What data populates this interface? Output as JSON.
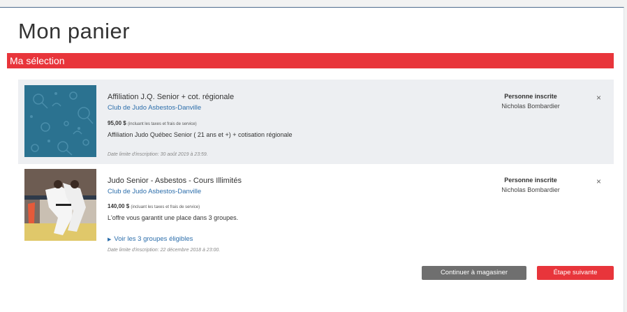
{
  "page": {
    "title": "Mon panier",
    "section_title": "Ma sélection"
  },
  "items": [
    {
      "name": "Affiliation J.Q. Senior + cot. régionale",
      "club": "Club de Judo Asbestos-Danville",
      "price": "95,00 $",
      "price_note": "(incluant les taxes et frais de service)",
      "description": "Affiliation Judo Québec Senior ( 21 ans et +) + cotisation régionale",
      "deadline": "Date limite d'inscription: 30 août 2019 à 23:59.",
      "person_label": "Personne inscrite",
      "person_name": "Nicholas Bombardier",
      "remove": "×"
    },
    {
      "name": "Judo Senior - Asbestos - Cours Illimités",
      "club": "Club de Judo Asbestos-Danville",
      "price": "140,00 $",
      "price_note": "(incluant les taxes et frais de service)",
      "description": "L'offre vous garantit une place dans 3 groupes.",
      "groups_link": "Voir les 3 groupes éligibles",
      "deadline": "Date limite d'inscription: 22 décembre 2018 à 23:00.",
      "person_label": "Personne inscrite",
      "person_name": "Nicholas Bombardier",
      "remove": "×"
    }
  ],
  "actions": {
    "continue_label": "Continuer à magasiner",
    "next_label": "Étape suivante"
  },
  "colors": {
    "accent": "#e8353b",
    "link": "#2c6eab",
    "thumb_teal": "#2b7290"
  },
  "icons": {
    "expand": "triangle-right-icon",
    "remove": "close-icon"
  }
}
